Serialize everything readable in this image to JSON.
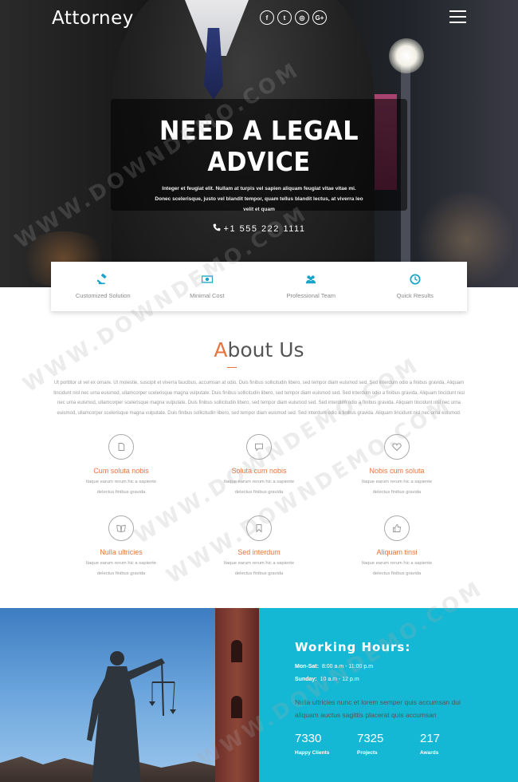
{
  "header": {
    "logo": "Attorney",
    "socials": [
      {
        "icon": "facebook-icon",
        "glyph": "f"
      },
      {
        "icon": "twitter-icon",
        "glyph": "t"
      },
      {
        "icon": "instagram-icon",
        "glyph": "◎"
      },
      {
        "icon": "google-plus-icon",
        "glyph": "G+"
      }
    ],
    "menu_icon": "hamburger-menu-icon"
  },
  "hero": {
    "title": "NEED A LEGAL ADVICE",
    "text": "Integer et feugiat elit. Nullam at turpis vel sapien aliquam feugiat vitae vitae mi. Donec scelerisque, justo vel blandit tempor, quam tellus blandit lectus, at viverra leo velit et quam",
    "phone_icon": "phone-icon",
    "phone": "+1 555 222 1111"
  },
  "features": [
    {
      "icon": "gavel-icon",
      "label": "Customized Solution"
    },
    {
      "icon": "money-icon",
      "label": "Minimal Cost"
    },
    {
      "icon": "team-icon",
      "label": "Professional Team"
    },
    {
      "icon": "clock-icon",
      "label": "Quick Results"
    }
  ],
  "about": {
    "title_first": "A",
    "title_rest": "bout Us",
    "text": "Ut porttitor ut vel ex ornare. Ut molestie, suscipit et viverra faucibus, accumsan at odio. Duis finibus sollicitudin libero, sed tempor diam euismod sed. Sed interdum odio a finibus gravida. Aliquam tincidunt nisl nec urna euismod, ullamcorper scelerisque magna vulputate. Duis finibus sollicitudin libero, sed tempor diam euismod sed. Sed interdum odio a finibus gravida. Aliquam tincidunt nisl nec urna euismod, ullamcorper scelerisque magna vulputate. Duis finibus sollicitudin libero, sed tempor diam euismod sed. Sed interdum odio a finibus gravida. Aliquam tincidunt nisl nec urna euismod, ullamcorper scelerisque magna vulputate. Duis finibus sollicitudin libero, sed tempor diam euismod sed. Sed interdum odio a finibus gravida. Aliquam tincidunt nisl nec urna euismod."
  },
  "services": [
    {
      "icon": "document-icon",
      "title": "Cum soluta nobis",
      "desc": "Itaque earum rerum hic a sapiente delectus finibus gravida"
    },
    {
      "icon": "chat-icon",
      "title": "Soluta cum nobis",
      "desc": "Itaque earum rerum hic a sapiente delectus finibus gravida"
    },
    {
      "icon": "heart-icon",
      "title": "Nobis cum soluta",
      "desc": "Itaque earum rerum hic a sapiente delectus finibus gravida"
    },
    {
      "icon": "book-icon",
      "title": "Nulla ultricies",
      "desc": "Itaque earum rerum hic a sapiente delectus finibus gravida"
    },
    {
      "icon": "bookmark-icon",
      "title": "Sed interdum",
      "desc": "Itaque earum rerum hic a sapiente delectus finibus gravida"
    },
    {
      "icon": "thumbs-up-icon",
      "title": "Aliquam tinsi",
      "desc": "Itaque earum rerum hic a sapiente delectus finibus gravida"
    }
  ],
  "hours": {
    "title": "Working Hours:",
    "rows": [
      {
        "day": "Mon-Sat:",
        "time": "8:00 a.m - 11:00 p.m"
      },
      {
        "day": "Sunday:",
        "time": "10 a.m - 12 p.m"
      }
    ],
    "text": "Nulla ultricies nunc et lorem semper quis accumsan dui aliquam auctus sagittis placerat quis accumsan",
    "stats": [
      {
        "num": "7330",
        "cap": "Happy Clients"
      },
      {
        "num": "7325",
        "cap": "Projects"
      },
      {
        "num": "217",
        "cap": "Awards"
      }
    ]
  },
  "watermark": "WWW.DOWNDEMO.COM",
  "colors": {
    "accent": "#e7743c",
    "teal": "#15b8d4",
    "feature_icon": "#1aa3c8"
  }
}
